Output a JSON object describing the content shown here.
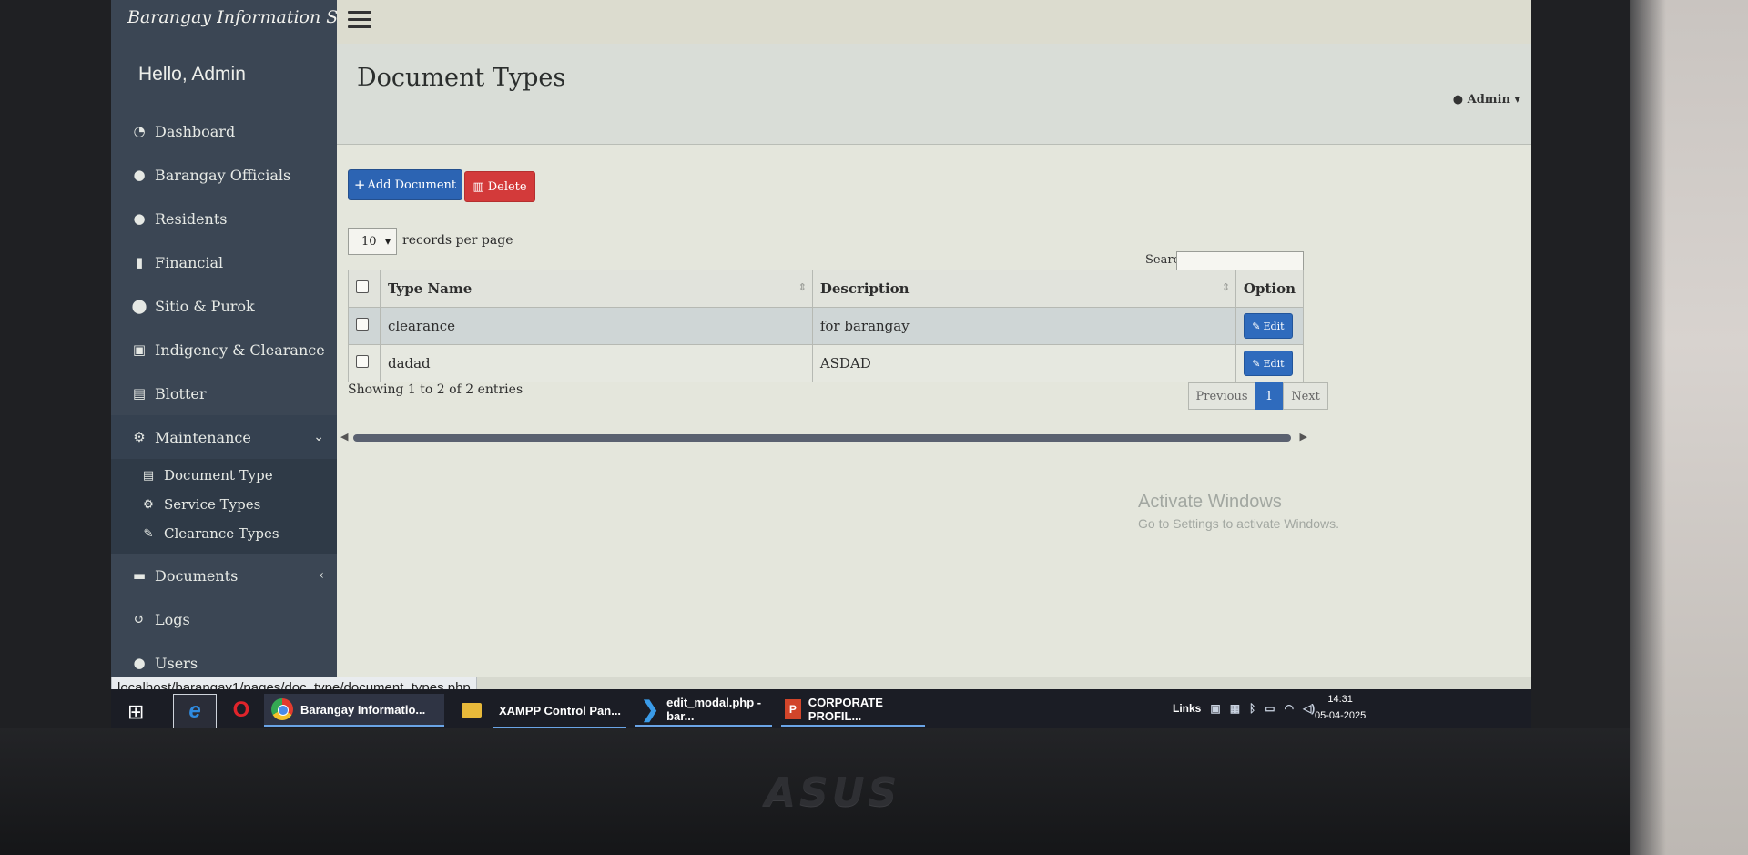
{
  "brand": "Barangay Information System",
  "greeting": "Hello, Admin",
  "user_menu": "Admin",
  "nav": {
    "items": [
      {
        "label": "Dashboard",
        "icon": "dashboard-icon"
      },
      {
        "label": "Barangay Officials",
        "icon": "officials-icon"
      },
      {
        "label": "Residents",
        "icon": "residents-icon"
      },
      {
        "label": "Financial",
        "icon": "financial-icon"
      },
      {
        "label": "Sitio & Purok",
        "icon": "map-pin-icon"
      },
      {
        "label": "Indigency & Clearance",
        "icon": "id-card-icon"
      },
      {
        "label": "Blotter",
        "icon": "blotter-icon"
      },
      {
        "label": "Maintenance",
        "icon": "cogs-icon"
      }
    ],
    "maintenance_sub": [
      {
        "label": "Document Type",
        "icon": "document-icon"
      },
      {
        "label": "Service Types",
        "icon": "cogs-icon"
      },
      {
        "label": "Clearance Types",
        "icon": "edit-icon"
      }
    ],
    "after": [
      {
        "label": "Documents",
        "icon": "folder-icon"
      },
      {
        "label": "Logs",
        "icon": "history-icon"
      },
      {
        "label": "Users",
        "icon": "users-icon"
      }
    ]
  },
  "page": {
    "title": "Document Types",
    "add_button": "Add Document",
    "delete_button": "Delete",
    "length_value": "10",
    "length_label": "records per page",
    "search_label": "Search:",
    "search_value": ""
  },
  "table": {
    "headers": {
      "type_name": "Type Name",
      "description": "Description",
      "option": "Option"
    },
    "rows": [
      {
        "type_name": "clearance",
        "description": "for barangay",
        "action": "Edit"
      },
      {
        "type_name": "dadad",
        "description": "ASDAD",
        "action": "Edit"
      }
    ],
    "info": "Showing 1 to 2 of 2 entries",
    "pager": {
      "prev": "Previous",
      "current": "1",
      "next": "Next"
    }
  },
  "watermark": {
    "title": "Activate Windows",
    "subtitle": "Go to Settings to activate Windows."
  },
  "status_url": "localhost/barangay1/pages/doc_type/document_types.php",
  "taskbar": {
    "apps": [
      {
        "label": "Barangay Informatio...",
        "icon": "chrome-icon"
      },
      {
        "label": "XAMPP Control Pan...",
        "icon": "xampp-icon"
      },
      {
        "label": "edit_modal.php - bar...",
        "icon": "vscode-icon"
      },
      {
        "label": "CORPORATE PROFIL...",
        "icon": "powerpoint-icon"
      }
    ],
    "tray_label": "Links",
    "time": "14:31",
    "date": "05-04-2025"
  },
  "colors": {
    "sidebar": "#3b4654",
    "primary": "#2c64b3",
    "danger": "#d33a3a",
    "taskbar": "#1b1d25"
  }
}
